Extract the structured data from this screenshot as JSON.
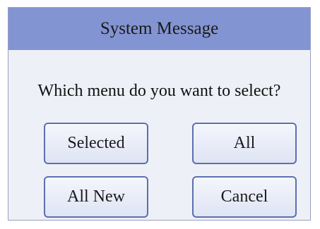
{
  "dialog": {
    "title": "System Message",
    "message": "Which menu do you want to select?",
    "buttons": {
      "selected": "Selected",
      "all": "All",
      "all_new": "All New",
      "cancel": "Cancel"
    }
  },
  "colors": {
    "title_bar": "#8394d2",
    "dialog_body": "#eef0f7",
    "button_border": "#5c6fb0",
    "button_fill": "#e8ecf8"
  }
}
